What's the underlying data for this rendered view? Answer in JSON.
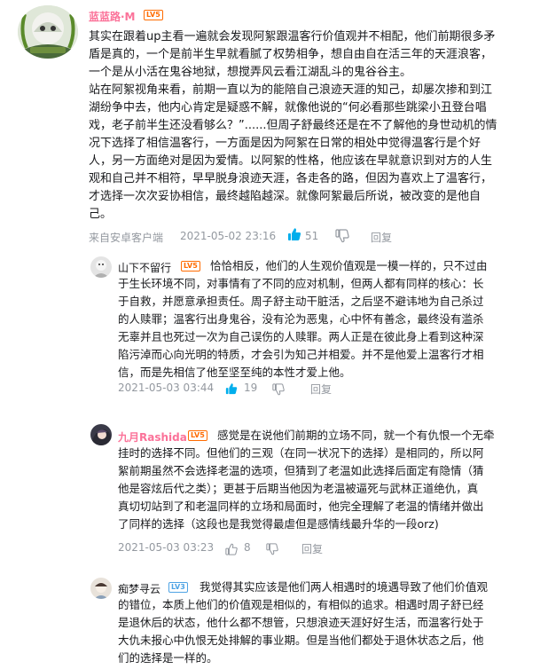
{
  "main_comment": {
    "username": "蓝蓝路·M",
    "level": "LV5",
    "lines": [
      "其实在跟着up主看一遍就会发现阿絮跟温客行价值观并不相配，他们前期很多矛",
      "盾是真的，一个是前半生早就看腻了权势相争，想自由自在活三年的天涯浪客，",
      "一个是从小活在鬼谷地狱，想搅弄风云看江湖乱斗的鬼谷谷主。",
      "站在阿絮视角来看，前期一直以为的能陪自己浪迹天涯的知己，却屡次掺和到江",
      "湖纷争中去，他内心肯定是疑惑不解，就像他说的“何必看那些跳梁小丑登台唱",
      "戏，老子前半生还没看够么？”......但周子舒最终还是在不了解他的身世动机的情",
      "况下选择了相信温客行，一方面是因为阿絮在日常的相处中觉得温客行是个好",
      "人，另一方面绝对是因为爱情。以阿絮的性格，他应该在早就意识到对方的人生",
      "观和自己并不相符，早早脱身浪迹天涯，各走各的路，但因为喜欢上了温客行，",
      "才选择一次次妥协相信，最终越陷越深。就像阿絮最后所说，被改变的是他自",
      "己。"
    ],
    "client": "来自安卓客户端",
    "time": "2021-05-02 23:16",
    "likes": "51",
    "reply": "回复"
  },
  "replies": [
    {
      "username": "山下不留行",
      "level": "LV5",
      "lines": [
        "恰恰相反，他们的人生观价值观是一模一样的，只不过由",
        "于生长环境不同，对事情有了不同的应对机制，但两人都有同样的核心：长",
        "于自救，并愿意承担责任。周子舒主动干脏活，之后坚不避讳地为自己杀过",
        "的人赎罪；温客行出身鬼谷，没有沦为恶鬼，心中怀有善念，最终没有滥杀",
        "无辜并且也死过一次为自己误伤的人赎罪。两人正是在彼此身上看到这种深",
        "陷污淖而心向光明的特质，才会引为知己并相爱。并不是他爱上温客行才相",
        "信，而是先相信了他至坚至纯的本性才爱上他。"
      ],
      "time": "2021-05-03 03:44",
      "likes": "19",
      "reply": "回复"
    },
    {
      "username": "九月Rashida",
      "level": "LV5",
      "lines": [
        "感觉是在说他们前期的立场不同，就一个有仇恨一个无牵",
        "挂时的选择不同。但他们的三观（在同一状况下的选择）是相同的，所以阿",
        "絮前期虽然不会选择老温的选项，但猜到了老温如此选择后面定有隐情（猜",
        "他是容炫后代之类）；更甚于后期当他因为老温被逼死与武林正道绝仇，真",
        "真切切站到了和老温同样的立场和局面时，他完全理解了老温的情绪并做出",
        "了同样的选择（这段也是我觉得最虐但是感情线最升华的一段orz)"
      ],
      "time": "2021-05-03 03:23",
      "likes": "8",
      "reply": "回复"
    },
    {
      "username": "痴梦寻云",
      "level": "LV3",
      "lines": [
        "我觉得其实应该是他们两人相遇时的境遇导致了他们价值观",
        "的错位，本质上他们的价值观是相似的，有相似的追求。相遇时周子舒已经",
        "是退休后的状态，他什么都不想管，只想浪迹天涯好好生活，而温客行处于",
        "大仇未报心中仇恨无处排解的事业期。但是当他们都处于退休状态之后，他",
        "们的选择是一样的。"
      ]
    }
  ],
  "colors": {
    "main_username": "#fb7299",
    "reply_username": "#18191c",
    "rashida_username": "#fb7299",
    "like_active": "#00aeec",
    "meta": "#9499a0"
  }
}
